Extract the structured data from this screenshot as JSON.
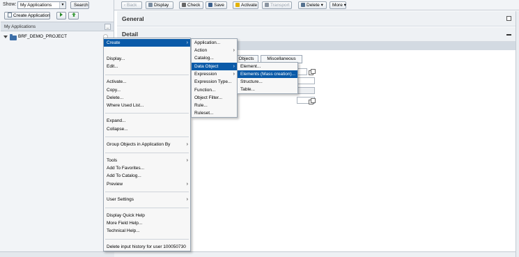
{
  "left": {
    "show_label": "Show:",
    "show_value": "My Applications",
    "search_label": "Search",
    "create_app_label": "Create Application",
    "panel_title": "My Applications",
    "collapse_symbol": "_",
    "tree_item": "BRF_DEMO_PROJECT"
  },
  "toolbar": {
    "back": "Back",
    "display": "Display",
    "check": "Check",
    "save": "Save",
    "activate": "Activate",
    "transport": "Transport",
    "delete": "Delete",
    "more": "More"
  },
  "content": {
    "general_title": "General",
    "detail_title": "Detail",
    "tabs": [
      "Objects",
      "Miscellaneous"
    ]
  },
  "context_menu": {
    "items": [
      "Create",
      "Display...",
      "Edit...",
      "Activate...",
      "Copy...",
      "Delete...",
      "Where Used List...",
      "Expand...",
      "Collapse...",
      "Group Objects in Application By",
      "Tools",
      "Add To Favorites...",
      "Add To Catalog...",
      "Preview",
      "User Settings",
      "Display Quick Help",
      "More Field Help...",
      "Technical Help...",
      "Delete input history for user 100050730"
    ]
  },
  "create_submenu": {
    "items": [
      "Application...",
      "Action",
      "Catalog...",
      "Data Object",
      "Expression",
      "Expression Type...",
      "Function...",
      "Object Filter...",
      "Rule...",
      "Ruleset..."
    ]
  },
  "data_object_submenu": {
    "items": [
      "Element...",
      "Elements (Mass creation)...",
      "Structure...",
      "Table..."
    ]
  },
  "colors": {
    "highlight": "#0a5aa8",
    "panel_bg": "#f2f4f7",
    "folder": "#3c6ea8"
  }
}
